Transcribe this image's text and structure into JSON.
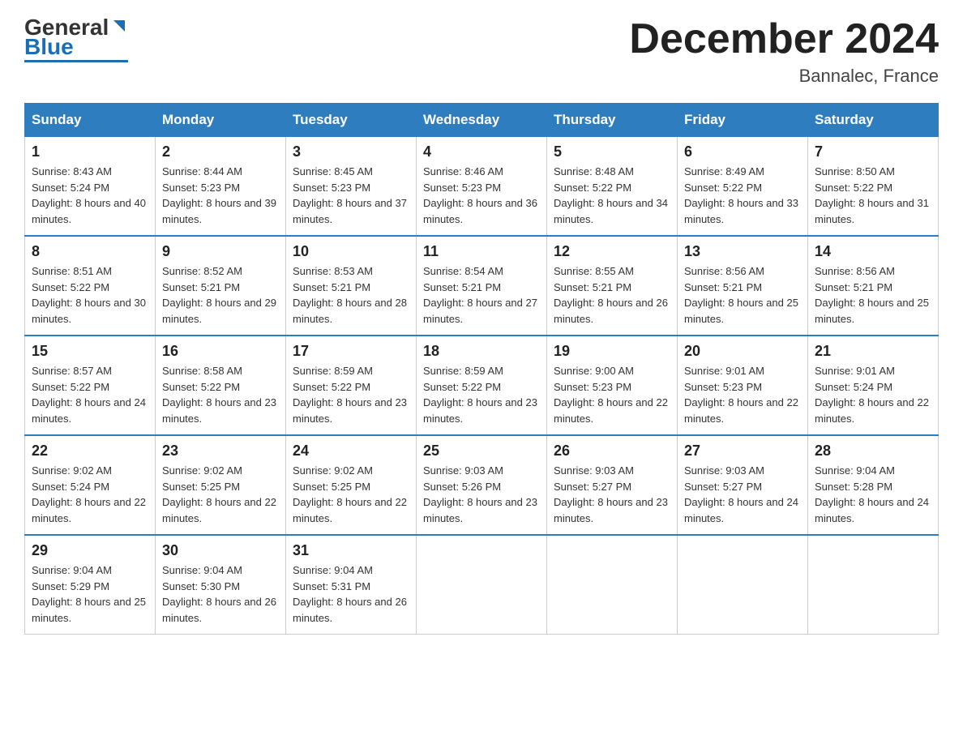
{
  "logo": {
    "general": "General",
    "blue": "Blue"
  },
  "title": "December 2024",
  "location": "Bannalec, France",
  "days_of_week": [
    "Sunday",
    "Monday",
    "Tuesday",
    "Wednesday",
    "Thursday",
    "Friday",
    "Saturday"
  ],
  "weeks": [
    [
      {
        "day": "1",
        "sunrise": "8:43 AM",
        "sunset": "5:24 PM",
        "daylight": "8 hours and 40 minutes."
      },
      {
        "day": "2",
        "sunrise": "8:44 AM",
        "sunset": "5:23 PM",
        "daylight": "8 hours and 39 minutes."
      },
      {
        "day": "3",
        "sunrise": "8:45 AM",
        "sunset": "5:23 PM",
        "daylight": "8 hours and 37 minutes."
      },
      {
        "day": "4",
        "sunrise": "8:46 AM",
        "sunset": "5:23 PM",
        "daylight": "8 hours and 36 minutes."
      },
      {
        "day": "5",
        "sunrise": "8:48 AM",
        "sunset": "5:22 PM",
        "daylight": "8 hours and 34 minutes."
      },
      {
        "day": "6",
        "sunrise": "8:49 AM",
        "sunset": "5:22 PM",
        "daylight": "8 hours and 33 minutes."
      },
      {
        "day": "7",
        "sunrise": "8:50 AM",
        "sunset": "5:22 PM",
        "daylight": "8 hours and 31 minutes."
      }
    ],
    [
      {
        "day": "8",
        "sunrise": "8:51 AM",
        "sunset": "5:22 PM",
        "daylight": "8 hours and 30 minutes."
      },
      {
        "day": "9",
        "sunrise": "8:52 AM",
        "sunset": "5:21 PM",
        "daylight": "8 hours and 29 minutes."
      },
      {
        "day": "10",
        "sunrise": "8:53 AM",
        "sunset": "5:21 PM",
        "daylight": "8 hours and 28 minutes."
      },
      {
        "day": "11",
        "sunrise": "8:54 AM",
        "sunset": "5:21 PM",
        "daylight": "8 hours and 27 minutes."
      },
      {
        "day": "12",
        "sunrise": "8:55 AM",
        "sunset": "5:21 PM",
        "daylight": "8 hours and 26 minutes."
      },
      {
        "day": "13",
        "sunrise": "8:56 AM",
        "sunset": "5:21 PM",
        "daylight": "8 hours and 25 minutes."
      },
      {
        "day": "14",
        "sunrise": "8:56 AM",
        "sunset": "5:21 PM",
        "daylight": "8 hours and 25 minutes."
      }
    ],
    [
      {
        "day": "15",
        "sunrise": "8:57 AM",
        "sunset": "5:22 PM",
        "daylight": "8 hours and 24 minutes."
      },
      {
        "day": "16",
        "sunrise": "8:58 AM",
        "sunset": "5:22 PM",
        "daylight": "8 hours and 23 minutes."
      },
      {
        "day": "17",
        "sunrise": "8:59 AM",
        "sunset": "5:22 PM",
        "daylight": "8 hours and 23 minutes."
      },
      {
        "day": "18",
        "sunrise": "8:59 AM",
        "sunset": "5:22 PM",
        "daylight": "8 hours and 23 minutes."
      },
      {
        "day": "19",
        "sunrise": "9:00 AM",
        "sunset": "5:23 PM",
        "daylight": "8 hours and 22 minutes."
      },
      {
        "day": "20",
        "sunrise": "9:01 AM",
        "sunset": "5:23 PM",
        "daylight": "8 hours and 22 minutes."
      },
      {
        "day": "21",
        "sunrise": "9:01 AM",
        "sunset": "5:24 PM",
        "daylight": "8 hours and 22 minutes."
      }
    ],
    [
      {
        "day": "22",
        "sunrise": "9:02 AM",
        "sunset": "5:24 PM",
        "daylight": "8 hours and 22 minutes."
      },
      {
        "day": "23",
        "sunrise": "9:02 AM",
        "sunset": "5:25 PM",
        "daylight": "8 hours and 22 minutes."
      },
      {
        "day": "24",
        "sunrise": "9:02 AM",
        "sunset": "5:25 PM",
        "daylight": "8 hours and 22 minutes."
      },
      {
        "day": "25",
        "sunrise": "9:03 AM",
        "sunset": "5:26 PM",
        "daylight": "8 hours and 23 minutes."
      },
      {
        "day": "26",
        "sunrise": "9:03 AM",
        "sunset": "5:27 PM",
        "daylight": "8 hours and 23 minutes."
      },
      {
        "day": "27",
        "sunrise": "9:03 AM",
        "sunset": "5:27 PM",
        "daylight": "8 hours and 24 minutes."
      },
      {
        "day": "28",
        "sunrise": "9:04 AM",
        "sunset": "5:28 PM",
        "daylight": "8 hours and 24 minutes."
      }
    ],
    [
      {
        "day": "29",
        "sunrise": "9:04 AM",
        "sunset": "5:29 PM",
        "daylight": "8 hours and 25 minutes."
      },
      {
        "day": "30",
        "sunrise": "9:04 AM",
        "sunset": "5:30 PM",
        "daylight": "8 hours and 26 minutes."
      },
      {
        "day": "31",
        "sunrise": "9:04 AM",
        "sunset": "5:31 PM",
        "daylight": "8 hours and 26 minutes."
      },
      null,
      null,
      null,
      null
    ]
  ]
}
